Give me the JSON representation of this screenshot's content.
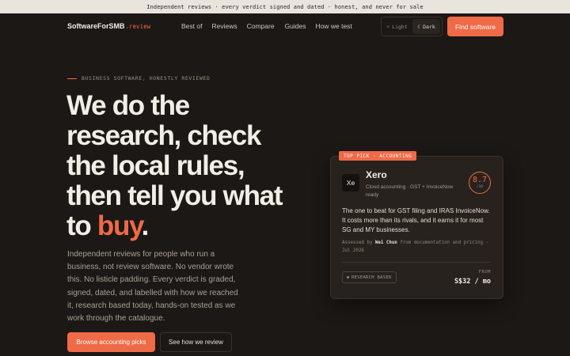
{
  "announcement": "Independent reviews · every verdict signed and dated · honest, and never for sale",
  "brand": {
    "name": "SoftwareForSMB",
    "tld": ".review"
  },
  "nav": {
    "links": [
      "Best of",
      "Reviews",
      "Compare",
      "Guides",
      "How we test"
    ]
  },
  "theme_toggle": {
    "light_icon": "☼",
    "light_label": "Light",
    "dark_icon": "☾",
    "dark_label": "Dark",
    "active": "Dark"
  },
  "cta_top": "Find software",
  "hero": {
    "eyebrow": "BUSINESS SOFTWARE, HONESTLY REVIEWED",
    "headline_main": "We do the research, check the local rules, then tell you what to ",
    "headline_accent": "buy",
    "headline_end": ".",
    "lede": "Independent reviews for people who run a business, not review software. No vendor wrote this. No listicle padding. Every verdict is graded, signed, dated, and labelled with how we reached it, research based today, hands-on tested as we work through the catalogue.",
    "primary_button": "Browse accounting picks",
    "secondary_button": "See how we review"
  },
  "card": {
    "tag": "TOP PICK · ACCOUNTING",
    "logo_text": "Xe",
    "name": "Xero",
    "subtitle": "Cloud accounting · GST + InvoiceNow ready",
    "score": "8.7",
    "score_of": "/10",
    "verdict": "The one to beat for GST filing and IRAS InvoiceNow. It costs more than its rivals, and it earns it for most SG and MY businesses.",
    "assessed_prefix": "Assessed by ",
    "assessed_by": "Wei Chun",
    "assessed_suffix": " from documentation and pricing · Jul 2026",
    "badge": "RESEARCH BASED",
    "from_label": "FROM",
    "price": "S$32 / mo"
  },
  "colors": {
    "accent": "#ef6a47",
    "background": "#1c1815",
    "card": "#28221e",
    "topbar": "#e9e4dc"
  }
}
